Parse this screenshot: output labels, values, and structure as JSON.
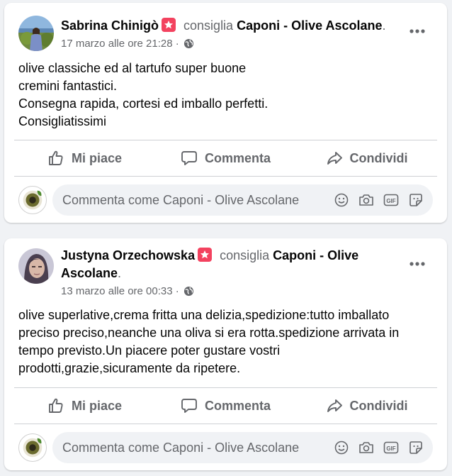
{
  "posts": [
    {
      "author": "Sabrina Chinigò",
      "verb": "consiglia",
      "page": "Caponi - Olive Ascolane",
      "period": ".",
      "timestamp": "17 marzo alle ore 21:28 ·",
      "text": "olive classiche ed al tartufo super buone\ncremini fantastici.\nConsegna rapida, cortesi ed imballo perfetti.\nConsigliatissimi",
      "actions": {
        "like": "Mi piace",
        "comment": "Comment​a",
        "share": "Condividi"
      },
      "comment_placeholder": "Commenta come Caponi - Olive Ascolane"
    },
    {
      "author": "Justyna Orzechowska",
      "verb": "consiglia",
      "page": "Caponi - Olive Ascolane",
      "period": ".",
      "timestamp": "13 marzo alle ore 00:33 ·",
      "text": "olive superlative,crema fritta una delizia,spedizione:tutto imballato\npreciso preciso,neanche una oliva si era rotta.spedizione arrivata in\ntempo previsto.Un piacere poter gustare vostri\nprodotti,grazie,sicuramente da ripetere.",
      "actions": {
        "like": "Mi piace",
        "comment": "Commenta",
        "share": "Condividi"
      },
      "comment_placeholder": "Commenta come Caponi - Olive Ascolane"
    }
  ],
  "colors": {
    "page_bg": "#f0f2f5",
    "card_bg": "#ffffff",
    "secondary_text": "#65676b",
    "recommend_badge": "#f3425f",
    "divider": "#ced0d4"
  },
  "icons": {
    "recommend": "recommend-star-badge-icon",
    "privacy": "globe-icon",
    "more": "more-horizontal-icon",
    "like": "thumbs-up-icon",
    "comment": "speech-bubble-icon",
    "share": "share-arrow-icon",
    "emoji": "smiley-icon",
    "camera": "camera-icon",
    "gif": "gif-icon",
    "sticker": "sticker-icon"
  }
}
